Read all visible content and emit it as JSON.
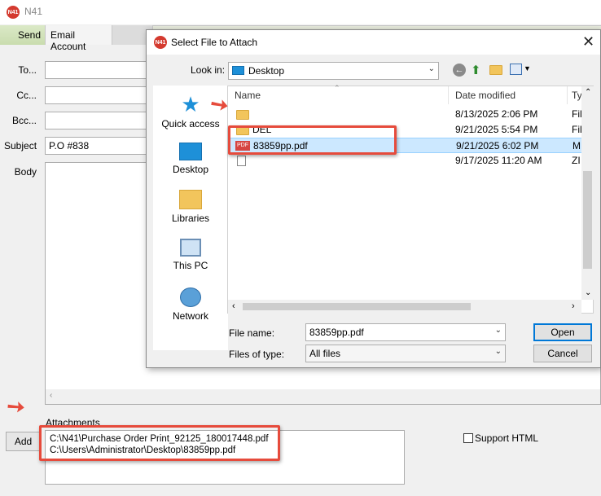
{
  "app": {
    "title": "N41",
    "logo_text": "N41"
  },
  "toolbar": {
    "send_label": "Send",
    "email_account_label": "Email Account"
  },
  "form": {
    "to_label": "To...",
    "cc_label": "Cc...",
    "bcc_label": "Bcc...",
    "subject_label": "Subject",
    "subject_value": "P.O #838",
    "body_label": "Body",
    "attachments_label": "Attachments",
    "add_label": "Add",
    "attachments": [
      "C:\\N41\\Purchase Order Print_92125_180017448.pdf",
      "C:\\Users\\Administrator\\Desktop\\83859pp.pdf"
    ],
    "support_html_label": "Support HTML"
  },
  "dialog": {
    "title": "Select File to Attach",
    "look_in_label": "Look in:",
    "look_in_value": "Desktop",
    "places": [
      "Quick access",
      "Desktop",
      "Libraries",
      "This PC",
      "Network"
    ],
    "columns": {
      "name": "Name",
      "date": "Date modified",
      "type": "Ty"
    },
    "rows": [
      {
        "name": "",
        "date": "8/13/2025 2:06 PM",
        "type": "Fil"
      },
      {
        "name": "DEL",
        "date": "9/21/2025 5:54 PM",
        "type": "Fil"
      },
      {
        "name": "83859pp.pdf",
        "date": "9/21/2025 6:02 PM",
        "type": "M"
      },
      {
        "name": "",
        "date": "9/17/2025 11:20 AM",
        "type": "ZI"
      }
    ],
    "file_name_label": "File name:",
    "file_name_value": "83859pp.pdf",
    "file_type_label": "Files of type:",
    "file_type_value": "All files",
    "open_label": "Open",
    "cancel_label": "Cancel"
  },
  "colors": {
    "highlight": "#e64b3c",
    "selection": "#cce8ff",
    "brand": "#d43a2f"
  }
}
